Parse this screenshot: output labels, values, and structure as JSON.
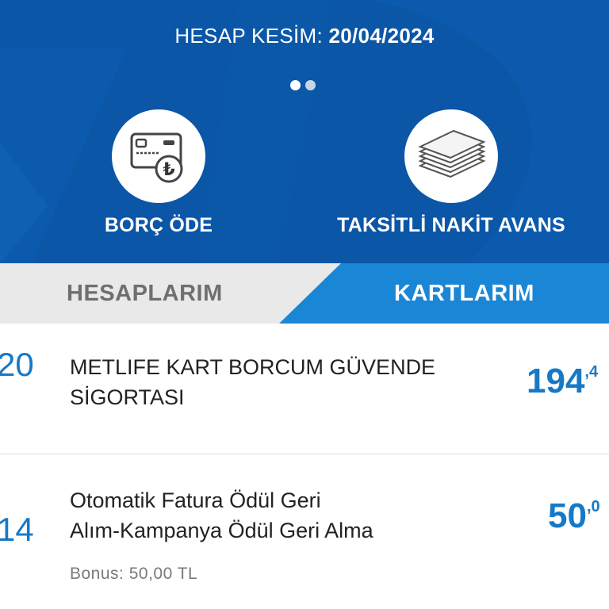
{
  "header": {
    "cut_label": "HESAP KESİM:",
    "cut_date": "20/04/2024",
    "pager": {
      "count": 2,
      "active_index": 0
    },
    "colors": {
      "background": "#0b56a6",
      "accent": "#1a86d6"
    }
  },
  "actions": [
    {
      "label": "BORÇ ÖDE",
      "icon": "card-lira-icon"
    },
    {
      "label": "TAKSİTLİ NAKİT AVANS",
      "icon": "banknotes-icon"
    }
  ],
  "tabs": {
    "accounts": "HESAPLARIM",
    "cards": "KARTLARIM",
    "active": "cards"
  },
  "transactions": [
    {
      "day": "20",
      "description_line1": "METLIFE KART BORCUM GÜVENDE",
      "description_line2": "SİGORTASI",
      "amount_int": "194",
      "amount_dec": ",4"
    },
    {
      "day": "14",
      "description_line1": "Otomatik Fatura Ödül Geri",
      "description_line2": "Alım-Kampanya Ödül Geri Alma",
      "amount_int": "50",
      "amount_dec": ",0",
      "bonus": "Bonus: 50,00 TL"
    }
  ]
}
